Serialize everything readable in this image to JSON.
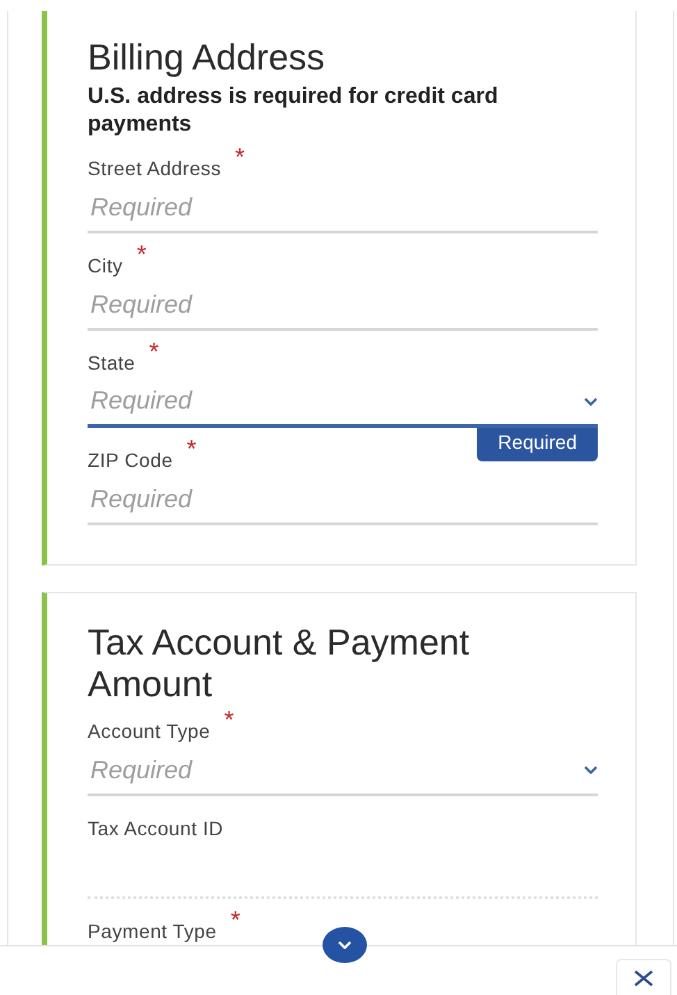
{
  "sections": [
    {
      "title": "Billing Address",
      "note": "U.S. address is required for credit card payments",
      "fields": [
        {
          "kind": "text",
          "label": "Street Address",
          "marker": "*",
          "placeholder": "Required",
          "focused": false,
          "disabled": false
        },
        {
          "kind": "text",
          "label": "City",
          "marker": "*",
          "placeholder": "Required",
          "focused": false,
          "disabled": false
        },
        {
          "kind": "select",
          "label": "State",
          "marker": "*",
          "placeholder": "Required",
          "focused": true,
          "disabled": false,
          "error": "Required"
        },
        {
          "kind": "text",
          "label": "ZIP Code",
          "marker": "*",
          "placeholder": "Required",
          "focused": false,
          "disabled": false
        }
      ]
    },
    {
      "title": "Tax Account & Payment Amount",
      "fields": [
        {
          "kind": "select",
          "label": "Account Type",
          "marker": "*",
          "placeholder": "Required",
          "focused": false,
          "disabled": false
        },
        {
          "kind": "text",
          "label": "Tax Account ID",
          "focused": false,
          "disabled": true
        },
        {
          "label": "Payment Type",
          "marker": "*"
        }
      ]
    }
  ]
}
